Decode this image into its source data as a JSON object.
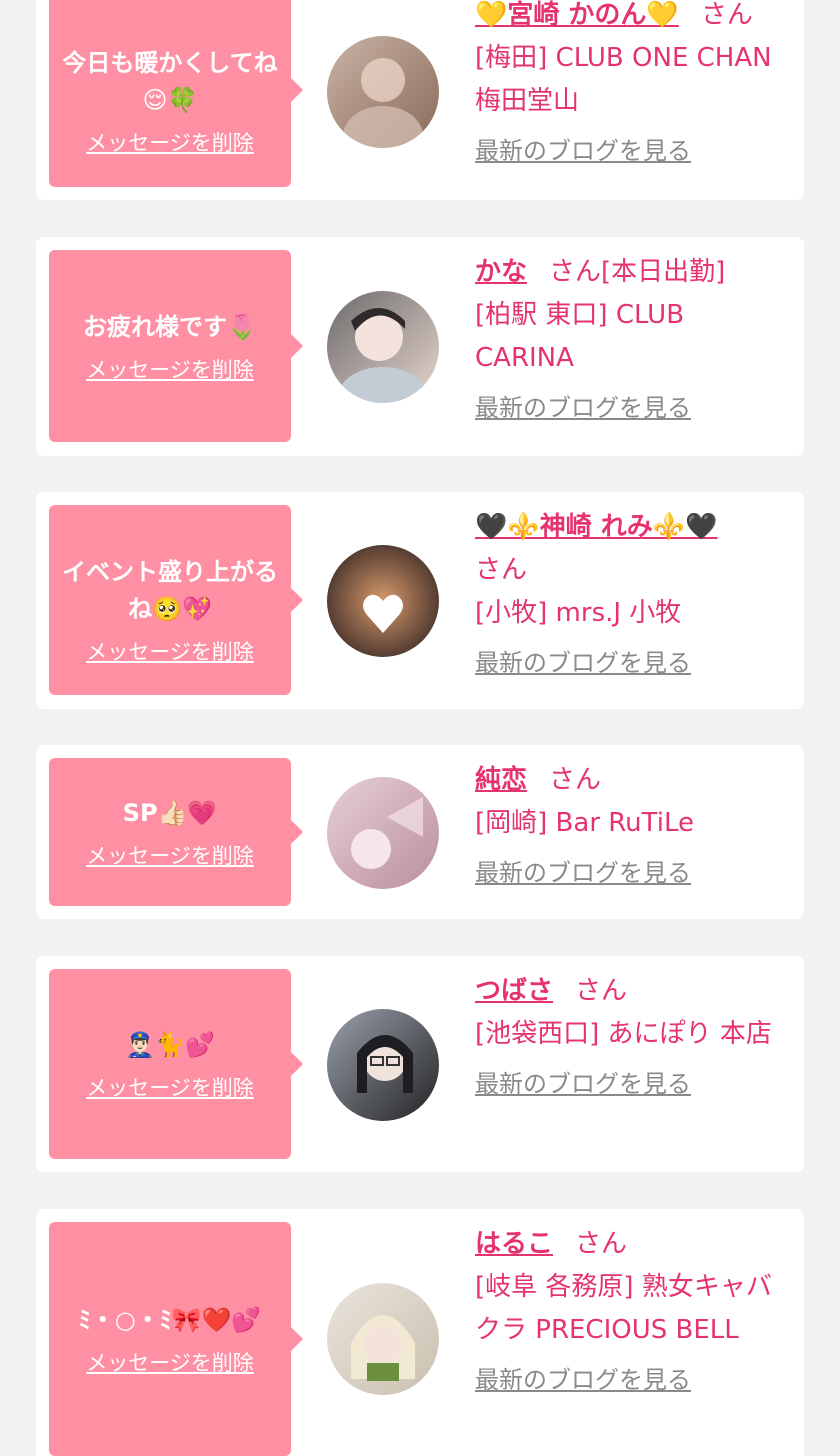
{
  "messages": [
    {
      "message": "今日も暖かくしてね😌🍀",
      "delete_label": "メッセージを削除",
      "name": "💛宮崎 かのん💛",
      "honorific": "さん",
      "shop": "[梅田] CLUB ONE CHAN 梅田堂山",
      "blog_link": "最新のブログを見る",
      "avatar_colors": [
        "#c9b3a6",
        "#8a6a58"
      ]
    },
    {
      "message": "お疲れ様です🌷",
      "delete_label": "メッセージを削除",
      "name": "かな",
      "honorific": "さん[本日出勤]",
      "shop": "[柏駅 東口] CLUB CARINA",
      "blog_link": "最新のブログを見る",
      "avatar_colors": [
        "#6a6a6a",
        "#e9d6cf"
      ]
    },
    {
      "message": "イベント盛り上がるね🥺💖",
      "delete_label": "メッセージを削除",
      "name": "🖤⚜️神崎 れみ⚜️🖤",
      "honorific": "さん",
      "shop": "[小牧] mrs.J 小牧",
      "blog_link": "最新のブログを見る",
      "avatar_colors": [
        "#3b2a26",
        "#d89a6c"
      ]
    },
    {
      "message": "SP👍🏻💗",
      "delete_label": "メッセージを削除",
      "name": "純恋",
      "honorific": "さん",
      "shop": "[岡崎] Bar RuTiLe",
      "blog_link": "最新のブログを見る",
      "avatar_colors": [
        "#e7cfd6",
        "#b98f9c"
      ]
    },
    {
      "message": "👮🏻‍♂️🐈💕",
      "delete_label": "メッセージを削除",
      "name": "つばさ",
      "honorific": "さん",
      "shop": "[池袋西口] あにぽり 本店",
      "blog_link": "最新のブログを見る",
      "avatar_colors": [
        "#9aa1ad",
        "#222222"
      ]
    },
    {
      "message": "ﾐ・○・ﾐ🎀❤️💕",
      "delete_label": "メッセージを削除",
      "name": "はるこ",
      "honorific": "さん",
      "shop": "[岐阜 各務原] 熟女キャバクラ PRECIOUS BELL",
      "blog_link": "最新のブログを見る",
      "avatar_colors": [
        "#e9e4dc",
        "#c9c0ae"
      ]
    }
  ]
}
